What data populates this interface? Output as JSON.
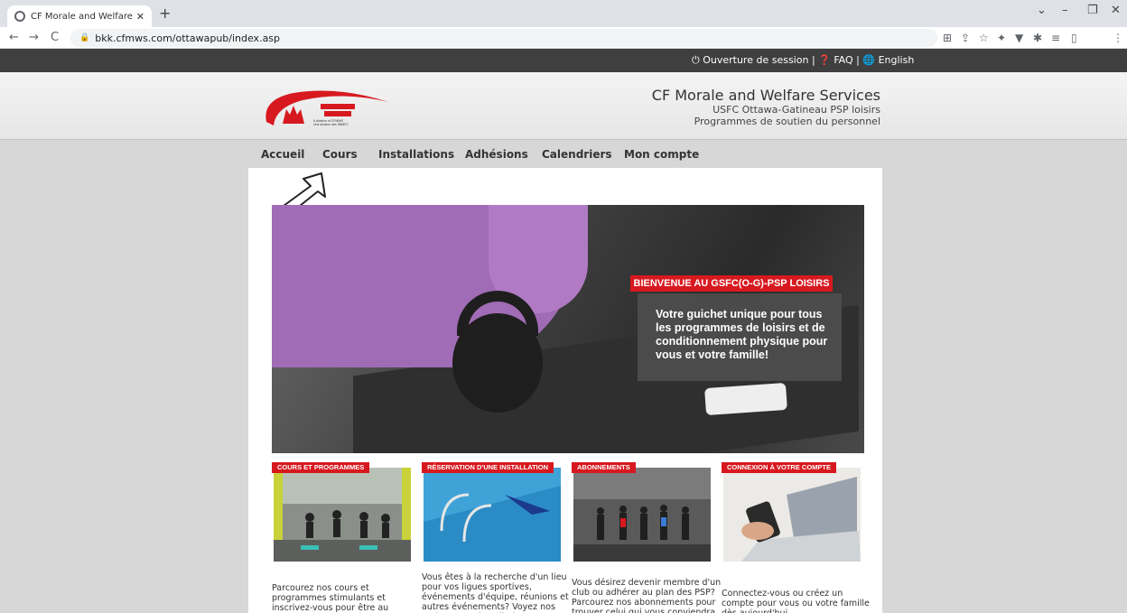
{
  "browser": {
    "tab_title": "CF Morale and Welfare Services",
    "tab_close": "✕",
    "new_tab": "+",
    "url": "bkk.cfmws.com/ottawapub/index.asp",
    "back": "←",
    "forward": "→",
    "reload": "C",
    "window_controls": [
      "⌄",
      "–",
      "❐",
      "✕"
    ]
  },
  "topbar": {
    "login": "Ouverture de session",
    "sep1": "|",
    "faq": "FAQ",
    "sep2": "|",
    "english": "English"
  },
  "header": {
    "org_name": "CF Morale and Welfare Services",
    "line2": "USFC Ottawa-Gatineau PSP loisirs",
    "line3": "Programmes de soutien du personnel",
    "logo_small_1": "A division of CFMWS",
    "logo_small_2": "Une division des SBMFC"
  },
  "nav": {
    "items": [
      "Accueil",
      "Cours",
      "Installations",
      "Adhésions",
      "Calendriers",
      "Mon compte"
    ],
    "highlighted": "Cours"
  },
  "hero": {
    "tag": "BIENVENUE AU GSFC(O-G)-PSP LOISIRS",
    "text": "Votre guichet unique pour tous les programmes de loisirs et de conditionnement physique pour vous et votre famille!"
  },
  "cards": [
    {
      "tag": "COURS ET PROGRAMMES",
      "text": "Parcourez nos cours et programmes stimulants et inscrivez-vous pour être au sommet de votre forme tout au long de l'année!"
    },
    {
      "tag": "RÉSERVATION D'UNE INSTALLATION",
      "text": "Vous êtes à la recherche d'un lieu pour vos ligues sportives, événements d'équipe, réunions et autres événements? Voyez nos options pour installations et réservez"
    },
    {
      "tag": "ABONNEMENTS",
      "text": "Vous désirez devenir membre d'un club ou adhérer au plan des PSP? Parcourez nos abonnements pour trouver celui qui vous conviendra le mieux"
    },
    {
      "tag": "CONNEXION À VOTRE COMPTE",
      "text": "Connectez-vous ou créez un compte pour vous ou votre famille dès aujourd'hui"
    }
  ],
  "colors": {
    "accent_red": "#d7191f",
    "topbar": "#3f3f3f",
    "highlight": "#f5f542"
  }
}
